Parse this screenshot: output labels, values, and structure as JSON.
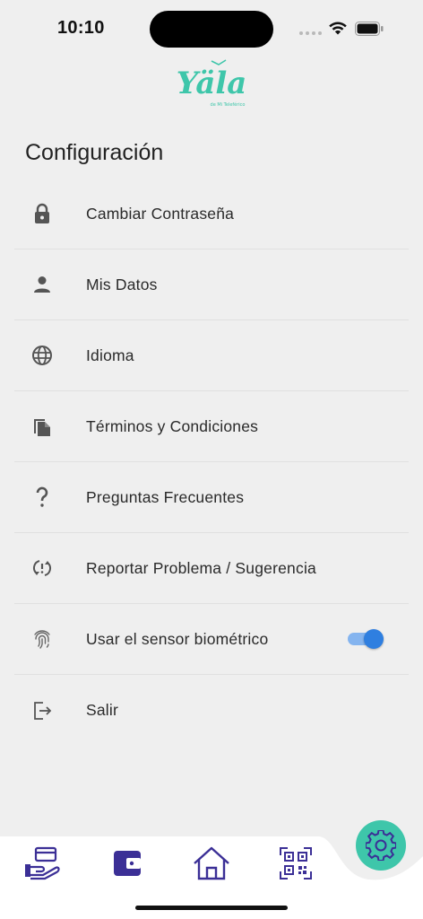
{
  "status_bar": {
    "time": "10:10"
  },
  "brand": {
    "logo_text": "Yäla",
    "logo_subtext": "de Mi Teleférico",
    "color": "#3ec6aa"
  },
  "page": {
    "title": "Configuración"
  },
  "menu": {
    "items": [
      {
        "label": "Cambiar Contraseña",
        "icon": "lock-icon"
      },
      {
        "label": "Mis Datos",
        "icon": "person-icon"
      },
      {
        "label": "Idioma",
        "icon": "globe-icon"
      },
      {
        "label": "Términos y Condiciones",
        "icon": "documents-icon"
      },
      {
        "label": "Preguntas Frecuentes",
        "icon": "question-icon"
      },
      {
        "label": "Reportar Problema / Sugerencia",
        "icon": "report-icon"
      },
      {
        "label": "Usar el sensor biométrico",
        "icon": "fingerprint-icon",
        "toggle_on": true
      },
      {
        "label": "Salir",
        "icon": "logout-icon"
      }
    ]
  },
  "bottom_nav": {
    "items": [
      "payment-hand-icon",
      "wallet-icon",
      "home-icon",
      "qr-code-icon"
    ],
    "active": "settings-gear-icon",
    "icon_color": "#3b2f96",
    "fab_color": "#3ec6aa"
  }
}
